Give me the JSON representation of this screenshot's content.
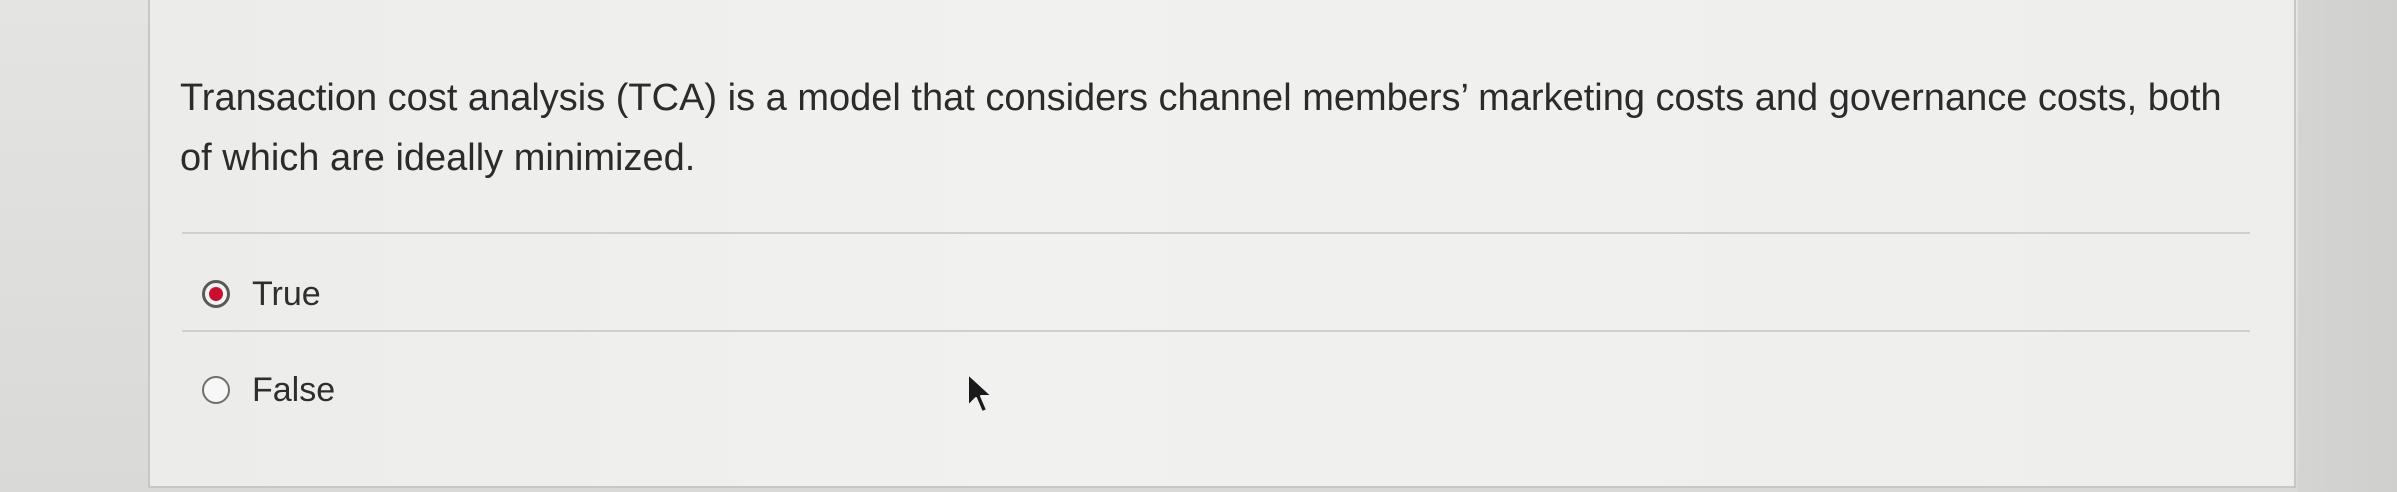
{
  "question": {
    "text": "Transaction cost analysis (TCA) is a model that considers channel members’ marketing costs and governance costs, both of which are ideally minimized."
  },
  "options": [
    {
      "label": "True",
      "selected": true
    },
    {
      "label": "False",
      "selected": false
    }
  ],
  "colors": {
    "selected_radio_fill": "#c8102e",
    "text": "#2b2b2b",
    "background": "#eeeeec"
  },
  "icons": {
    "cursor": "arrow-pointer-icon"
  }
}
